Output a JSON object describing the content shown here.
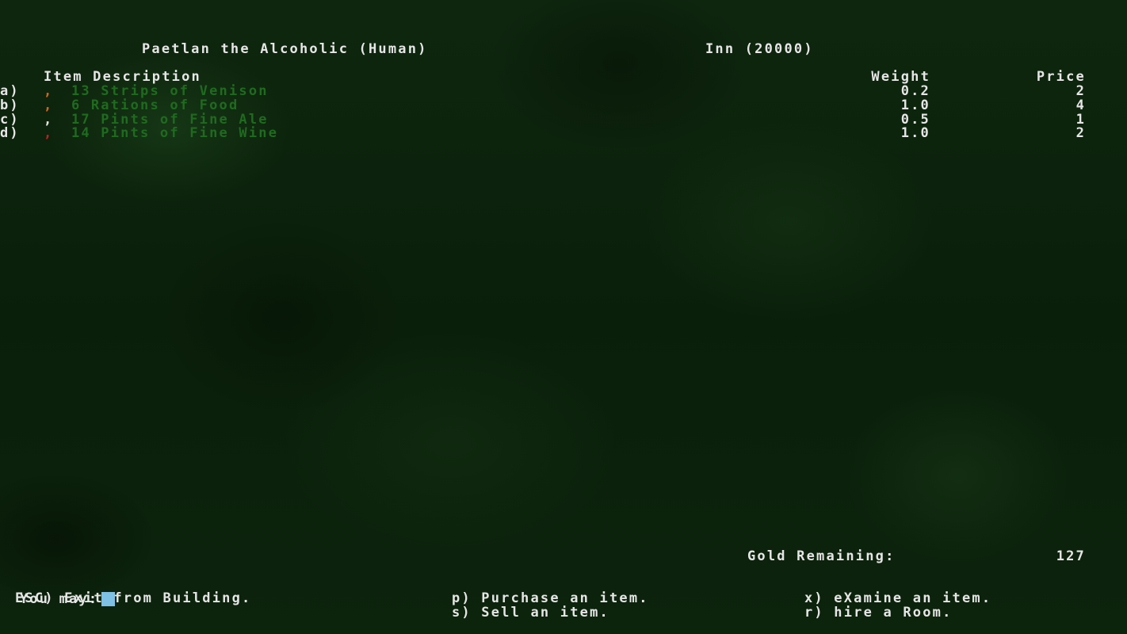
{
  "header": {
    "owner": "Paetlan the Alcoholic (Human)",
    "store": "Inn (20000)"
  },
  "columns": {
    "description": "Item Description",
    "weight": "Weight",
    "price": "Price"
  },
  "items": [
    {
      "letter": "a)",
      "symbol": ",",
      "symbol_color": "#d06a1a",
      "name": "13 Strips of Venison",
      "weight": "0.2",
      "price": "2"
    },
    {
      "letter": "b)",
      "symbol": ",",
      "symbol_color": "#d06a1a",
      "name": "6 Rations of Food",
      "weight": "1.0",
      "price": "4"
    },
    {
      "letter": "c)",
      "symbol": ",",
      "symbol_color": "#e6e6e6",
      "name": "17 Pints of Fine Ale",
      "weight": "0.5",
      "price": "1"
    },
    {
      "letter": "d)",
      "symbol": ",",
      "symbol_color": "#c02020",
      "name": "14 Pints of Fine Wine",
      "weight": "1.0",
      "price": "2"
    }
  ],
  "gold": {
    "label": "Gold Remaining:",
    "value": "127"
  },
  "prompt": {
    "label": "You may:"
  },
  "commands": {
    "esc": "ESC) Exit from Building.",
    "purchase": "p) Purchase an item.",
    "examine": "x) eXamine an item.",
    "sell": "s) Sell an item.",
    "room": "r) hire a Room."
  },
  "colors": {
    "item_text": "#1f6b1f",
    "text": "#e6e6e6",
    "cursor": "#7ec0e6"
  }
}
